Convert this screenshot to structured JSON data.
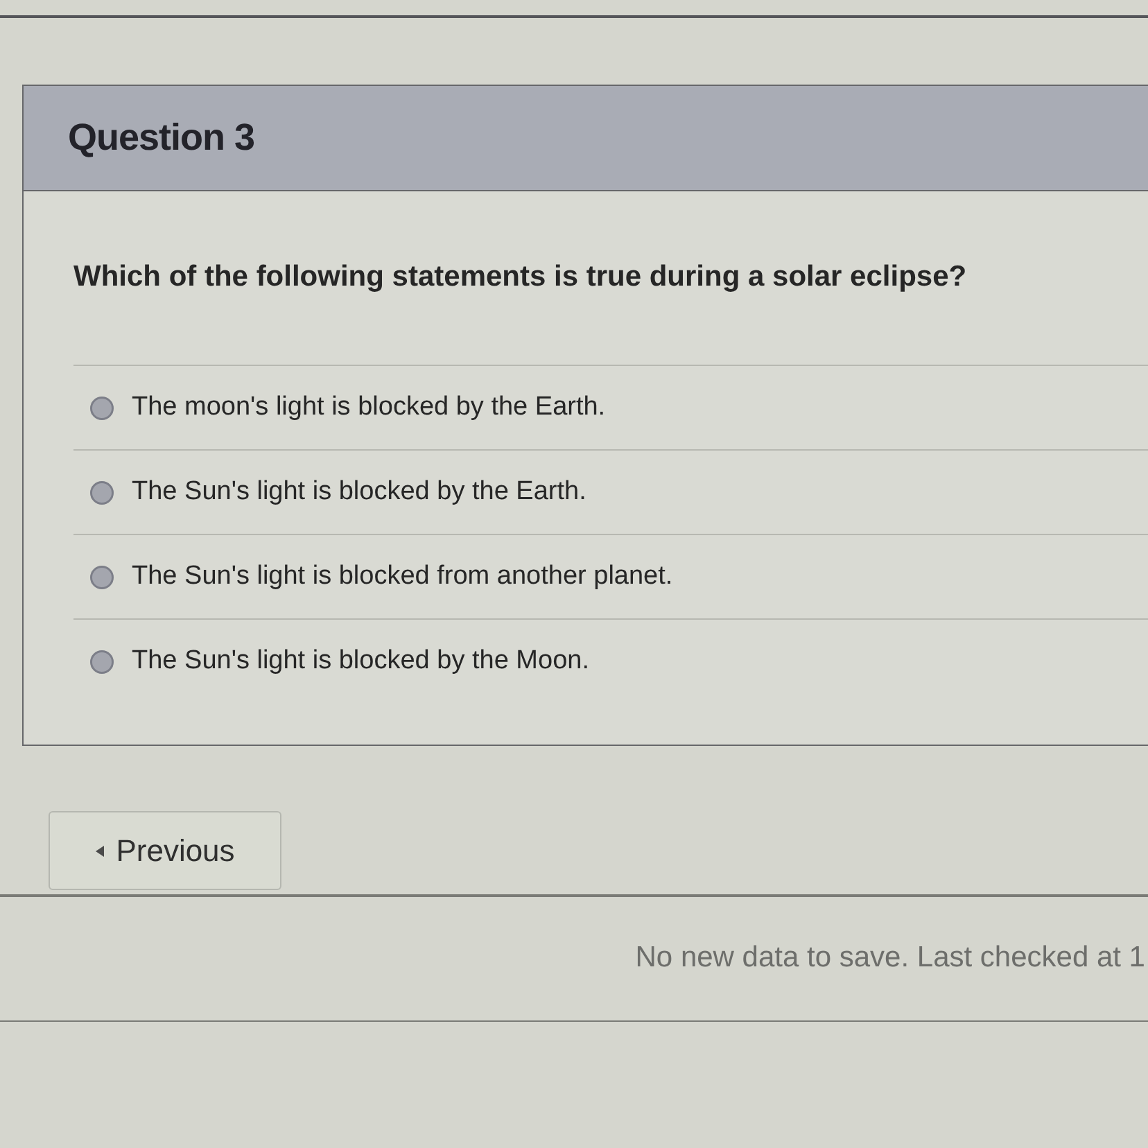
{
  "question": {
    "title": "Question 3",
    "text": "Which of the following statements is true during a solar eclipse?",
    "options": [
      {
        "label": "The moon's light is blocked by the Earth.",
        "selected": false
      },
      {
        "label": "The Sun's light is blocked by the Earth.",
        "selected": false
      },
      {
        "label": "The Sun's light is blocked from another planet.",
        "selected": false
      },
      {
        "label": "The Sun's light is blocked by the Moon.",
        "selected": false
      }
    ]
  },
  "previous_button": {
    "label": "Previous"
  },
  "status": "No new data to save. Last checked at 1"
}
